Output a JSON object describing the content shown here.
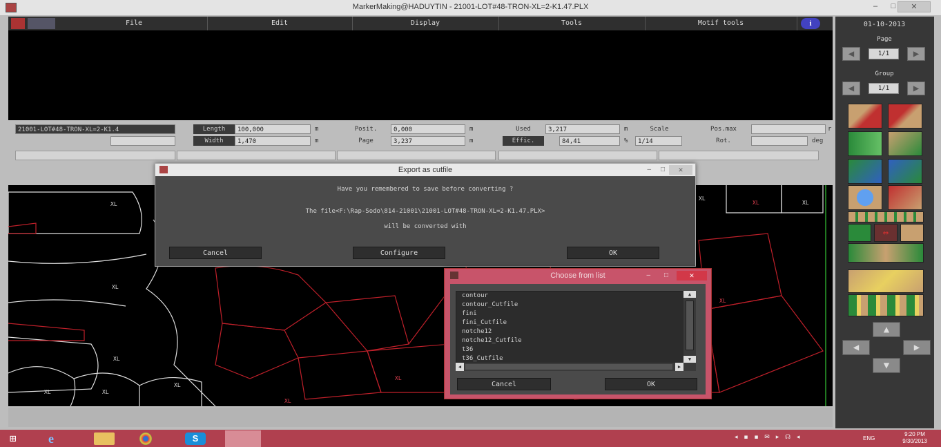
{
  "window": {
    "title": "MarkerMaking@HADUYTIN - 21001-LOT#48-TRON-XL=2-K1.47.PLX"
  },
  "menu": [
    "File",
    "Edit",
    "Display",
    "Tools",
    "Motif tools"
  ],
  "fields": {
    "filename": "21001-LOT#48-TRON-XL=2-K1.4",
    "length_label": "Length",
    "length_value": "100,000",
    "length_unit": "m",
    "width_label": "Width",
    "width_value": "1,470",
    "width_unit": "m",
    "posit_label": "Posit.",
    "posit_value": "0,000",
    "posit_unit": "m",
    "page_label": "Page",
    "page_value": "3,237",
    "page_unit": "m",
    "used_label": "Used",
    "used_value": "3,217",
    "used_unit": "m",
    "effic_label": "Effic.",
    "effic_value": "84,41",
    "effic_unit": "%",
    "scale_label": "Scale",
    "scale_value": "1/14",
    "posmax_label": "Pos.max",
    "rot_label": "Rot.",
    "rot_unit": "deg",
    "posmax_unit": "r"
  },
  "right_panel": {
    "date": "01-10-2013",
    "page_label": "Page",
    "page_value": "1/1",
    "group_label": "Group",
    "group_value": "1/1"
  },
  "export_dialog": {
    "title": "Export as cutfile",
    "line1": "Have you remembered to save before converting ?",
    "line2": "The file<F:\\Rap-Sodo\\814-21001\\21001-LOT#48-TRON-XL=2-K1.47.PLX>",
    "line3": "will be converted with",
    "cancel": "Cancel",
    "configure": "Configure",
    "ok": "OK"
  },
  "choose_dialog": {
    "title": "Choose from list",
    "items": [
      "contour",
      "contour_Cutfile",
      "fini",
      "fini_Cutfile",
      "notche12",
      "notche12_Cutfile",
      "t36",
      "t36_Cutfile"
    ],
    "cancel": "Cancel",
    "ok": "OK"
  },
  "canvas_labels": [
    "XL",
    "XL",
    "XL",
    "XL",
    "XL",
    "XL",
    "XL",
    "XL",
    "XL",
    "XL",
    "XL",
    "XL"
  ],
  "taskbar": {
    "lang": "ENG",
    "time": "9:20 PM",
    "date": "9/30/2013"
  },
  "colors": {
    "taskbar": "#b0404f",
    "accent": "#c8546a",
    "piece_red": "#c0202a",
    "piece_white": "#e0e0e0"
  }
}
